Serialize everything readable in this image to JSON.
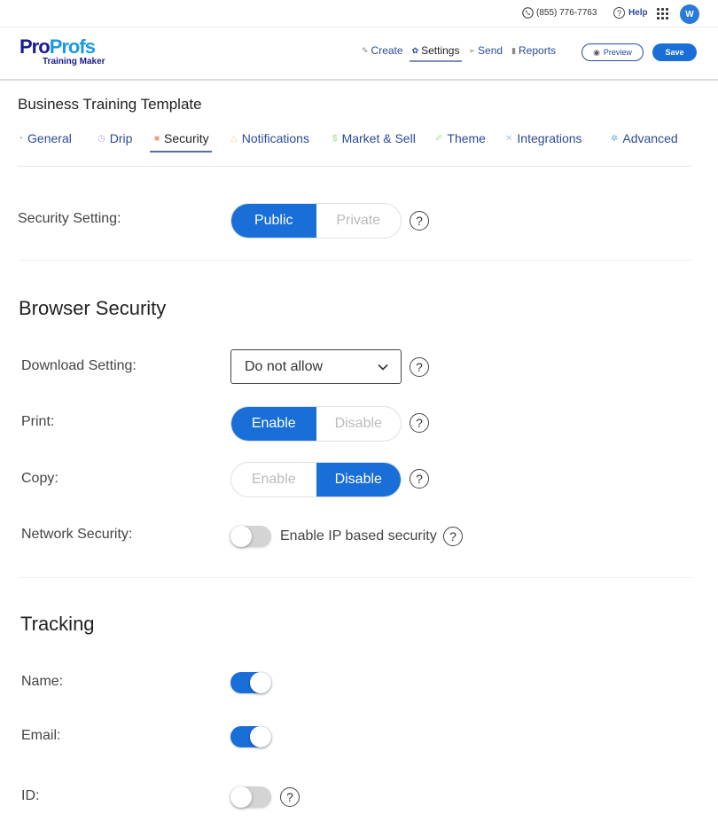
{
  "topbar": {
    "phone": "(855) 776-7763",
    "help_label": "Help",
    "avatar_initial": "W"
  },
  "header": {
    "logo": {
      "pro": "Pro",
      "profs": "Profs",
      "sub": "Training Maker"
    },
    "nav": [
      {
        "label": "Create",
        "icon": "pencil-icon",
        "active": false
      },
      {
        "label": "Settings",
        "icon": "gear-icon",
        "active": true
      },
      {
        "label": "Send",
        "icon": "send-icon",
        "active": false
      },
      {
        "label": "Reports",
        "icon": "bar-chart-icon",
        "active": false
      }
    ],
    "preview_label": "Preview",
    "save_label": "Save"
  },
  "page": {
    "title": "Business Training Template",
    "tabs": [
      {
        "label": "General",
        "icon": "gauge-icon",
        "color": "#6fc0d8",
        "active": false
      },
      {
        "label": "Drip",
        "icon": "clock-icon",
        "color": "#b8a8e8",
        "active": false
      },
      {
        "label": "Security",
        "icon": "lock-icon",
        "color": "#f0a080",
        "active": true
      },
      {
        "label": "Notifications",
        "icon": "bell-icon",
        "color": "#f5c8a0",
        "active": false
      },
      {
        "label": "Market & Sell",
        "icon": "dollar-icon",
        "color": "#a8d890",
        "active": false
      },
      {
        "label": "Theme",
        "icon": "brush-icon",
        "color": "#b0e0a0",
        "active": false
      },
      {
        "label": "Integrations",
        "icon": "tools-icon",
        "color": "#a8c8d8",
        "active": false
      },
      {
        "label": "Advanced",
        "icon": "gears-icon",
        "color": "#6ab0e0",
        "active": false
      }
    ]
  },
  "security_setting": {
    "label": "Security Setting:",
    "options": [
      "Public",
      "Private"
    ],
    "selected": "Public"
  },
  "browser_security": {
    "title": "Browser Security",
    "download": {
      "label": "Download Setting:",
      "value": "Do not allow"
    },
    "print": {
      "label": "Print:",
      "options": [
        "Enable",
        "Disable"
      ],
      "selected": "Enable"
    },
    "copy": {
      "label": "Copy:",
      "options": [
        "Enable",
        "Disable"
      ],
      "selected": "Disable"
    },
    "network": {
      "label": "Network Security:",
      "toggle_label": "Enable IP based security",
      "enabled": false
    }
  },
  "tracking": {
    "title": "Tracking",
    "name": {
      "label": "Name:",
      "enabled": true
    },
    "email": {
      "label": "Email:",
      "enabled": true
    },
    "id": {
      "label": "ID:",
      "enabled": false
    }
  },
  "colors": {
    "primary": "#1a6ed8",
    "nav_text": "#2a4a9a",
    "logo_dark": "#1a1a8c",
    "logo_light": "#1a9ae0"
  }
}
